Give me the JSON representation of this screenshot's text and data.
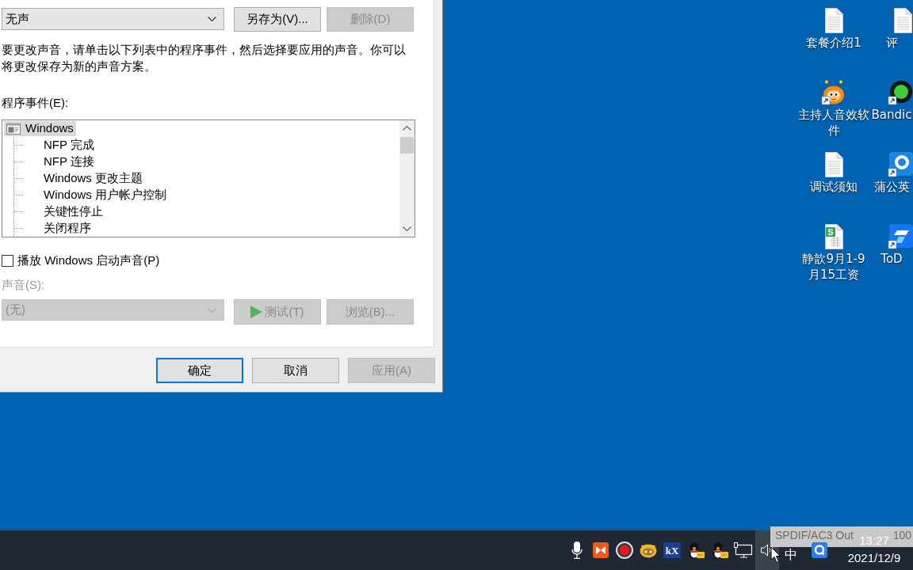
{
  "dialog": {
    "scheme": {
      "value": "无声",
      "buttons": [
        {
          "label": "另存为(V)...",
          "disabled": false
        },
        {
          "label": "删除(D)",
          "disabled": true
        }
      ]
    },
    "instructions": "要更改声音，请单击以下列表中的程序事件，然后选择要应用的声音。你可以将更改保存为新的声音方案。",
    "events": {
      "label": "程序事件(E):",
      "items": [
        {
          "label": "Windows",
          "selected": true,
          "children": [
            {
              "label": "NFP 完成",
              "selected": false
            },
            {
              "label": "NFP 连接",
              "selected": false
            },
            {
              "label": "Windows 更改主题",
              "selected": false
            },
            {
              "label": "Windows 用户帐户控制",
              "selected": false
            },
            {
              "label": "关键性停止",
              "selected": false
            },
            {
              "label": "关闭程序",
              "selected": false
            }
          ]
        }
      ]
    },
    "startup_sound": {
      "label": "播放 Windows 启动声音(P)",
      "checked": false
    },
    "sound": {
      "label": "声音(S):",
      "value": "(无)",
      "disabled": true,
      "buttons": [
        {
          "label": "测试(T)",
          "kind": "play",
          "disabled": true
        },
        {
          "label": "浏览(B)...",
          "kind": "plain",
          "disabled": true
        }
      ]
    },
    "footer_buttons": [
      {
        "label": "确定",
        "default": true,
        "disabled": false
      },
      {
        "label": "取消",
        "default": false,
        "disabled": false
      },
      {
        "label": "应用(A)",
        "default": false,
        "disabled": true
      }
    ]
  },
  "desktop": {
    "columns": [
      [
        {
          "label": "套餐介绍1",
          "kind": "document",
          "shortcut": false
        },
        {
          "label": "主持人音效软件",
          "kind": "mascot",
          "shortcut": true
        },
        {
          "label": "调试须知",
          "kind": "document",
          "shortcut": false
        },
        {
          "label": "静歆9月1-9月15工资",
          "kind": "spreadsheet",
          "badge": "S",
          "shortcut": false
        }
      ],
      [
        {
          "label": "评",
          "kind": "document",
          "shortcut": false
        },
        {
          "label": "Bandic",
          "kind": "record-app",
          "shortcut": true
        },
        {
          "label": "蒲公英",
          "kind": "ring-app",
          "shortcut": true
        },
        {
          "label": "ToD",
          "kind": "remote-app",
          "shortcut": true
        }
      ]
    ]
  },
  "taskbar": {
    "tray": [
      {
        "kind": "microphone",
        "highlighted": false
      },
      {
        "kind": "bow-app",
        "highlighted": false
      },
      {
        "kind": "record",
        "highlighted": false
      },
      {
        "kind": "mascot-app",
        "highlighted": false
      },
      {
        "kind": "kx",
        "label": "kX",
        "highlighted": false
      },
      {
        "kind": "penguin",
        "highlighted": false
      },
      {
        "kind": "penguin",
        "highlighted": false
      },
      {
        "kind": "network",
        "highlighted": false
      },
      {
        "kind": "speaker",
        "highlighted": true
      },
      {
        "kind": "ime",
        "label": "中",
        "highlighted": false
      },
      {
        "kind": "q-app",
        "highlighted": false
      }
    ],
    "tooltip": {
      "parts": [
        "SPDIF/AC3 Out",
        "100"
      ]
    },
    "clock": {
      "time": "13:27",
      "date": "2021/12/9"
    }
  }
}
